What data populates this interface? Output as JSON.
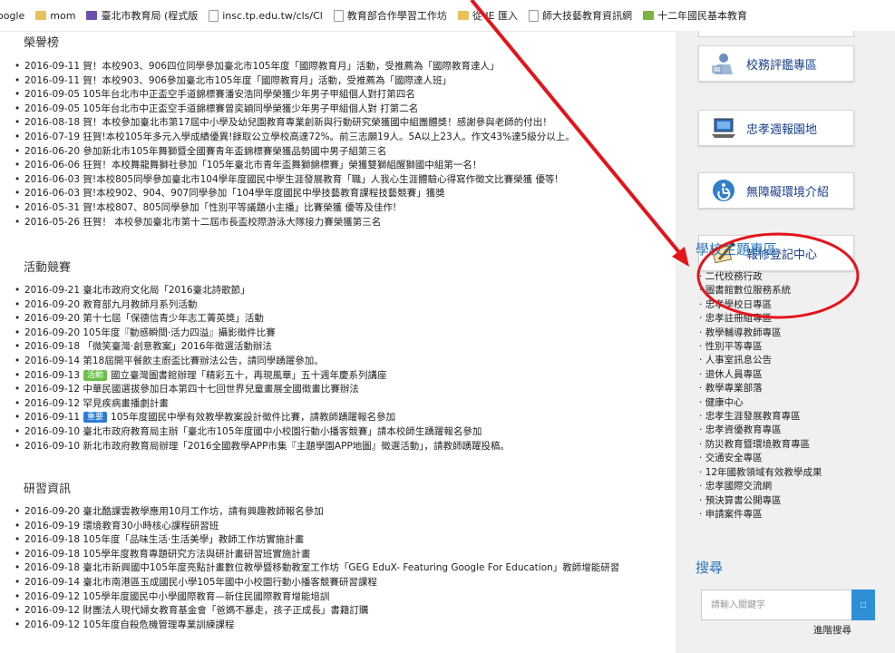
{
  "bookmarks": [
    {
      "label": "oogle",
      "icon": "none"
    },
    {
      "label": "mom",
      "icon": "folder-icon"
    },
    {
      "label": "臺北市教育局 (程式版",
      "icon": "book-icon"
    },
    {
      "label": "insc.tp.edu.tw/cls/Cl",
      "icon": "page-icon"
    },
    {
      "label": "教育部合作學習工作坊",
      "icon": "page-icon"
    },
    {
      "label": "從 IE 匯入",
      "icon": "folder-icon"
    },
    {
      "label": "師大技藝教育資訊網",
      "icon": "page-icon"
    },
    {
      "label": "十二年國民基本教育",
      "icon": "leaf-icon"
    }
  ],
  "honor": {
    "title": "榮譽榜",
    "items": [
      "2016-09-11 賀！本校903、906四位同學參加臺北市105年度「國際教育月」活動，受推薦為「國際教育達人」",
      "2016-09-11 賀！本校903、906參加臺北市105年度「國際教育月」活動，受推薦為「國際達人班」",
      "2016-09-05 105年台北市中正盃空手道錦標賽潘安浩同學榮獲少年男子甲組個人對打第四名",
      "2016-09-05 105年台北市中正盃空手道錦標賽曾奕穎同學榮獲少年男子甲組個人對 打第二名",
      "2016-08-18 賀！本校參加臺北市第17屆中小學及幼兒園教育專業創新與行動研究榮獲國中組團體獎！感謝參與老師的付出！",
      "2016-07-19 狂賀!本校105年多元入學成績優異!錄取公立學校高達72%。前三志願19人。5A以上23人。作文43%達5級分以上。",
      "2016-06-20 參加新北市105年舞獅暨全國賽青年盃錦標賽榮獲品勢國中男子組第三名",
      "2016-06-06 狂賀！本校舞龍舞獅社參加「105年臺北市青年盃舞獅錦標賽」榮獲雙獅組醒獅國中組第一名！",
      "2016-06-03 賀!本校805同學參加臺北市104學年度國民中學生涯發展教育「職」人我心生涯體驗心得寫作徵文比賽榮獲 優等!",
      "2016-06-03 賀!本校902、904、907同學參加「104學年度國民中學技藝教育課程技藝競賽」獲獎",
      "2016-05-31 賀!本校807、805同學參加「性別平等議題小主播」比賽榮獲 優等及佳作!",
      "2016-05-26 狂賀！ 本校參加臺北市第十二屆市長盃校際游泳大隊接力賽榮獲第三名"
    ]
  },
  "events": {
    "title": "活動競賽",
    "items": [
      {
        "text": "2016-09-21 臺北市政府文化局「2016臺北詩歌節」",
        "tag": "",
        "tag_color": ""
      },
      {
        "text": "2016-09-20 教育部九月教師月系列活動",
        "tag": "",
        "tag_color": ""
      },
      {
        "text": "2016-09-20 第十七屆「保德信青少年志工菁英獎」活動",
        "tag": "",
        "tag_color": ""
      },
      {
        "text": "2016-09-20 105年度『動感瞬間‧活力四溢』攝影徵件比賽",
        "tag": "",
        "tag_color": ""
      },
      {
        "text": "2016-09-18 「微笑臺灣‧創意教案」2016年徵選活動辦法",
        "tag": "",
        "tag_color": ""
      },
      {
        "text": "2016-09-14 第18屆開平餐飲主廚盃比賽辦法公告，請同學踴躍參加。",
        "tag": "",
        "tag_color": ""
      },
      {
        "text": "2016-09-13",
        "tag": "活動",
        "tag_color": "#6cc04a",
        "rest": "國立臺灣圖書館辦理「精彩五十，再現風華」五十週年慶系列講座"
      },
      {
        "text": "2016-09-12 中華民國選拔參加日本第四十七回世界兒童畫展全國徵畫比賽辦法",
        "tag": "",
        "tag_color": ""
      },
      {
        "text": "2016-09-12 罕見疾病畫播劇計畫",
        "tag": "",
        "tag_color": ""
      },
      {
        "text": "2016-09-11",
        "tag": "重要",
        "tag_color": "#2b7bd6",
        "rest": "105年度國民中學有效教學教案設計徵件比賽，請教師踴躍報名參加"
      },
      {
        "text": "2016-09-10 臺北市政府教育局主辦「臺北市105年度國中小校園行動小播客競賽」請本校師生踴躍報名參加",
        "tag": "",
        "tag_color": ""
      },
      {
        "text": "2016-09-10 新北市政府教育局辦理「2016全國教學APP市集『主題學園APP地圖』徵選活動」，請教師踴躍投稿。",
        "tag": "",
        "tag_color": ""
      }
    ]
  },
  "research": {
    "title": "研習資訊",
    "items": [
      "2016-09-20 臺北酷課雲教學應用10月工作坊，請有興趣教師報名參加",
      "2016-09-19 環境教育30小時核心課程研習班",
      "2016-09-18 105年度「品味生活‧生活美學」教師工作坊實施計畫",
      "2016-09-18 105學年度教育專題研究方法與研計畫研習班實施計畫",
      "2016-09-18 臺北市新興國中105年度亮點計畫數位教學暨移動教室工作坊「GEG EduX- Featuring Google For Education」教師增能研習",
      "2016-09-14 臺北市南港區玉成國民小學105年國中小校園行動小播客競賽研習課程",
      "2016-09-12 105學年度國民中小學國際教育—新住民國際教育增能培訓",
      "2016-09-12 財團法人現代婦女教育基金會「爸媽不暴走，孩子正成長」書籍訂購",
      "2016-09-12 105年度自殺危機管理專業訓練課程"
    ]
  },
  "side_buttons": [
    {
      "label": "校務評鑑專區",
      "icon": "evaluation-icon"
    },
    {
      "label": "忠孝週報園地",
      "icon": "laptop-icon"
    },
    {
      "label": "無障礙環境介紹",
      "icon": "accessibility-icon"
    },
    {
      "label": "報修登記中心",
      "icon": "repair-icon"
    }
  ],
  "topics": {
    "title": "學校主題專區",
    "items": [
      "二代校務行政",
      "圖書館數位服務系統",
      "忠孝學校日專區",
      "忠孝註冊組專區",
      "教學輔導教師專區",
      "性別平等專區",
      "人事室訊息公告",
      "退休人員專區",
      "教學專業部落",
      "健康中心",
      "忠孝生涯發展教育專區",
      "忠孝資優教育專區",
      "防災教育暨環境教育專區",
      "交通安全專區",
      "12年國教領域有效教學成果",
      "忠孝國際交流網",
      "預決算書公開專區",
      "申請案件專區"
    ]
  },
  "search": {
    "title": "搜尋",
    "placeholder": "請輸入關鍵字",
    "button_glyph": "□",
    "advanced": "進階搜尋"
  },
  "colors": {
    "annotation": "#e4141b",
    "side_heading": "#2a73b8",
    "button_text": "#1a3e8c",
    "search_button": "#2d8fd6"
  }
}
